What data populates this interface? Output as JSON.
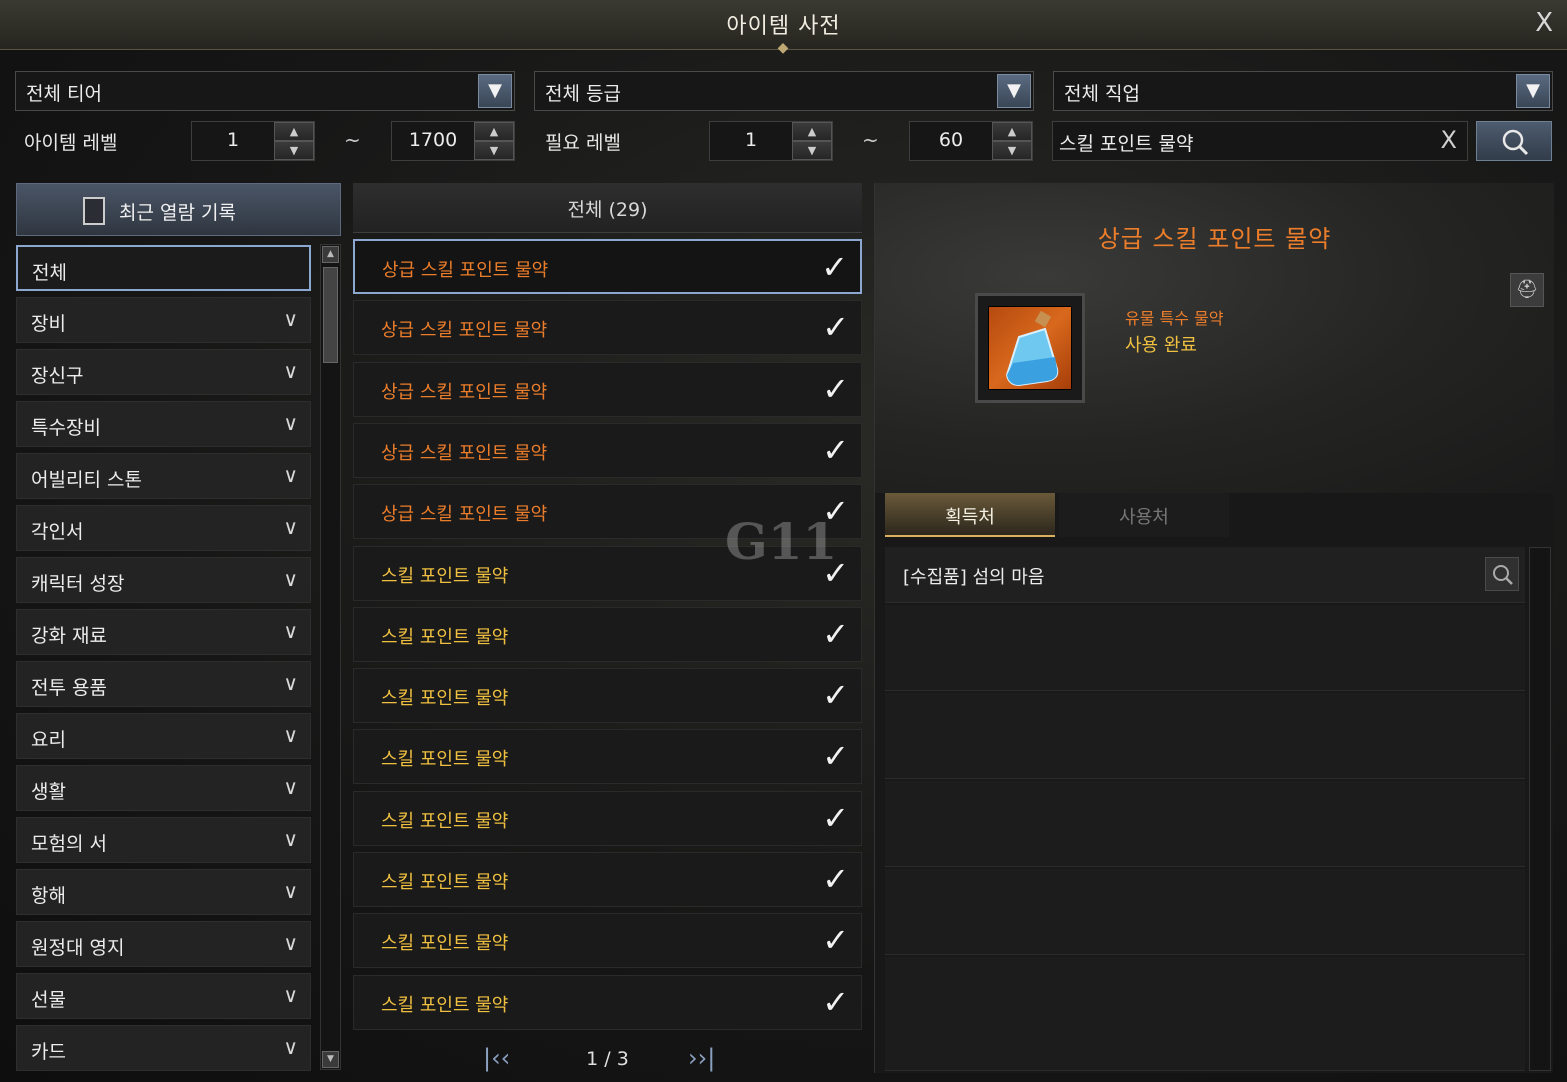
{
  "window": {
    "title": "아이템 사전",
    "close_label": "X"
  },
  "filters": {
    "tier": "전체 티어",
    "grade": "전체 등급",
    "class": "전체 직업",
    "item_level_label": "아이템 레벨",
    "item_level_min": "1",
    "item_level_max": "1700",
    "req_level_label": "필요 레벨",
    "req_level_min": "1",
    "req_level_max": "60",
    "tilde": "~",
    "search_value": "스킬 포인트 물약",
    "search_clear": "X"
  },
  "sidebar": {
    "recent_label": "최근 열람 기록",
    "categories": [
      "전체",
      "장비",
      "장신구",
      "특수장비",
      "어빌리티 스톤",
      "각인서",
      "캐릭터 성장",
      "강화 재료",
      "전투 용품",
      "요리",
      "생활",
      "모험의 서",
      "항해",
      "원정대 영지",
      "선물",
      "카드"
    ]
  },
  "list": {
    "header": "전체 (29)",
    "items": [
      {
        "name": "상급 스킬 포인트 물약",
        "color": "#ec7d2a"
      },
      {
        "name": "상급 스킬 포인트 물약",
        "color": "#ec7d2a"
      },
      {
        "name": "상급 스킬 포인트 물약",
        "color": "#ec7d2a"
      },
      {
        "name": "상급 스킬 포인트 물약",
        "color": "#ec7d2a"
      },
      {
        "name": "상급 스킬 포인트 물약",
        "color": "#ec7d2a"
      },
      {
        "name": "스킬 포인트 물약",
        "color": "#f0c040"
      },
      {
        "name": "스킬 포인트 물약",
        "color": "#f0c040"
      },
      {
        "name": "스킬 포인트 물약",
        "color": "#f0c040"
      },
      {
        "name": "스킬 포인트 물약",
        "color": "#f0c040"
      },
      {
        "name": "스킬 포인트 물약",
        "color": "#f0c040"
      },
      {
        "name": "스킬 포인트 물약",
        "color": "#f0c040"
      },
      {
        "name": "스킬 포인트 물약",
        "color": "#f0c040"
      },
      {
        "name": "스킬 포인트 물약",
        "color": "#f0c040"
      }
    ],
    "check": "✓",
    "pagination": "1 / 3"
  },
  "detail": {
    "name": "상급 스킬 포인트 물약",
    "type": "유물 특수 물약",
    "status": "사용 완료",
    "tabs": {
      "acquire": "획득처",
      "use": "사용처"
    },
    "sources": [
      "[수집품] 섬의 마음"
    ]
  },
  "watermark": "G11",
  "colors": {
    "relic": "#ec7d2a",
    "legendary": "#f0c040",
    "accent": "#8da8d0"
  }
}
